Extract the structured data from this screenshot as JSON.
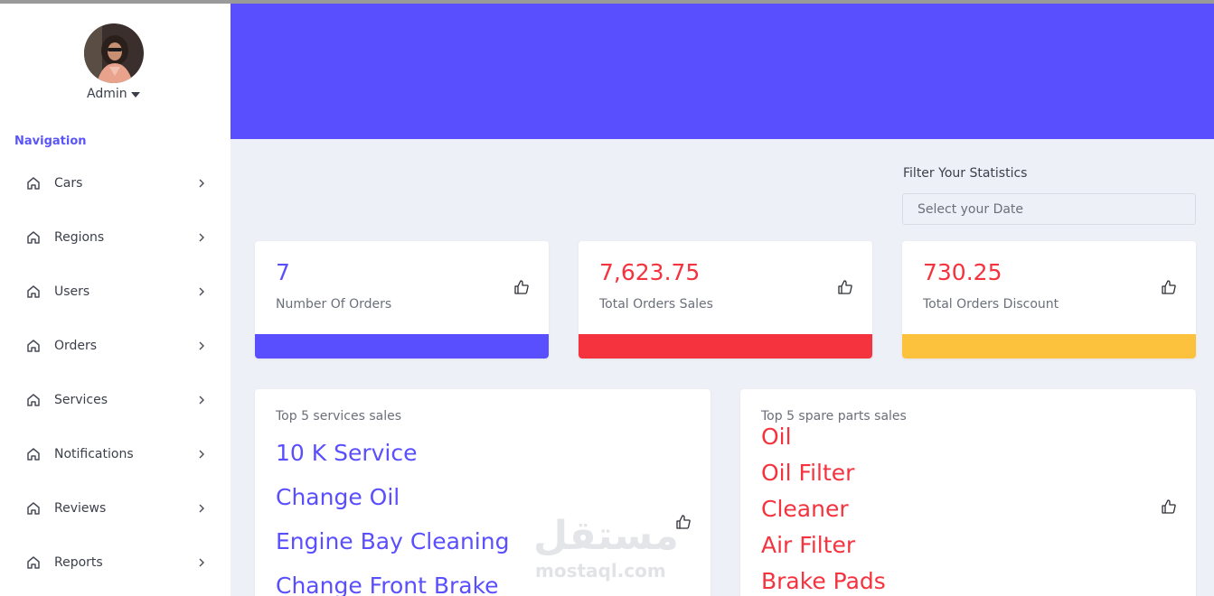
{
  "user": {
    "name": "Admin"
  },
  "navigation": {
    "title": "Navigation",
    "items": [
      {
        "label": "Cars"
      },
      {
        "label": "Regions"
      },
      {
        "label": "Users"
      },
      {
        "label": "Orders"
      },
      {
        "label": "Services"
      },
      {
        "label": "Notifications"
      },
      {
        "label": "Reviews"
      },
      {
        "label": "Reports"
      }
    ]
  },
  "filter": {
    "label": "Filter Your Statistics",
    "placeholder": "Select your Date"
  },
  "stats": [
    {
      "value": "7",
      "label": "Number Of Orders",
      "color": "#5a4fff"
    },
    {
      "value": "7,623.75",
      "label": "Total Orders Sales",
      "color": "#f4333f"
    },
    {
      "value": "730.25",
      "label": "Total Orders Discount",
      "color": "#fcc13d"
    }
  ],
  "top_services": {
    "title": "Top 5 services sales",
    "items": [
      "10 K Service",
      "Change Oil",
      "Engine Bay Cleaning",
      "Change Front Brake"
    ]
  },
  "top_parts": {
    "title": "Top 5 spare parts sales",
    "items": [
      "Oil",
      "Oil Filter",
      "Cleaner",
      "Air Filter",
      "Brake Pads"
    ]
  },
  "watermark": {
    "arabic": "مستقل",
    "latin": "mostaql.com"
  },
  "colors": {
    "accent": "#5a4fff",
    "danger": "#f4333f",
    "warning": "#fcc13d",
    "background": "#eef0f7"
  },
  "icons": {
    "nav": "house-icon",
    "chevron": "chevron-right-icon",
    "stat": "thumbs-up-icon"
  }
}
